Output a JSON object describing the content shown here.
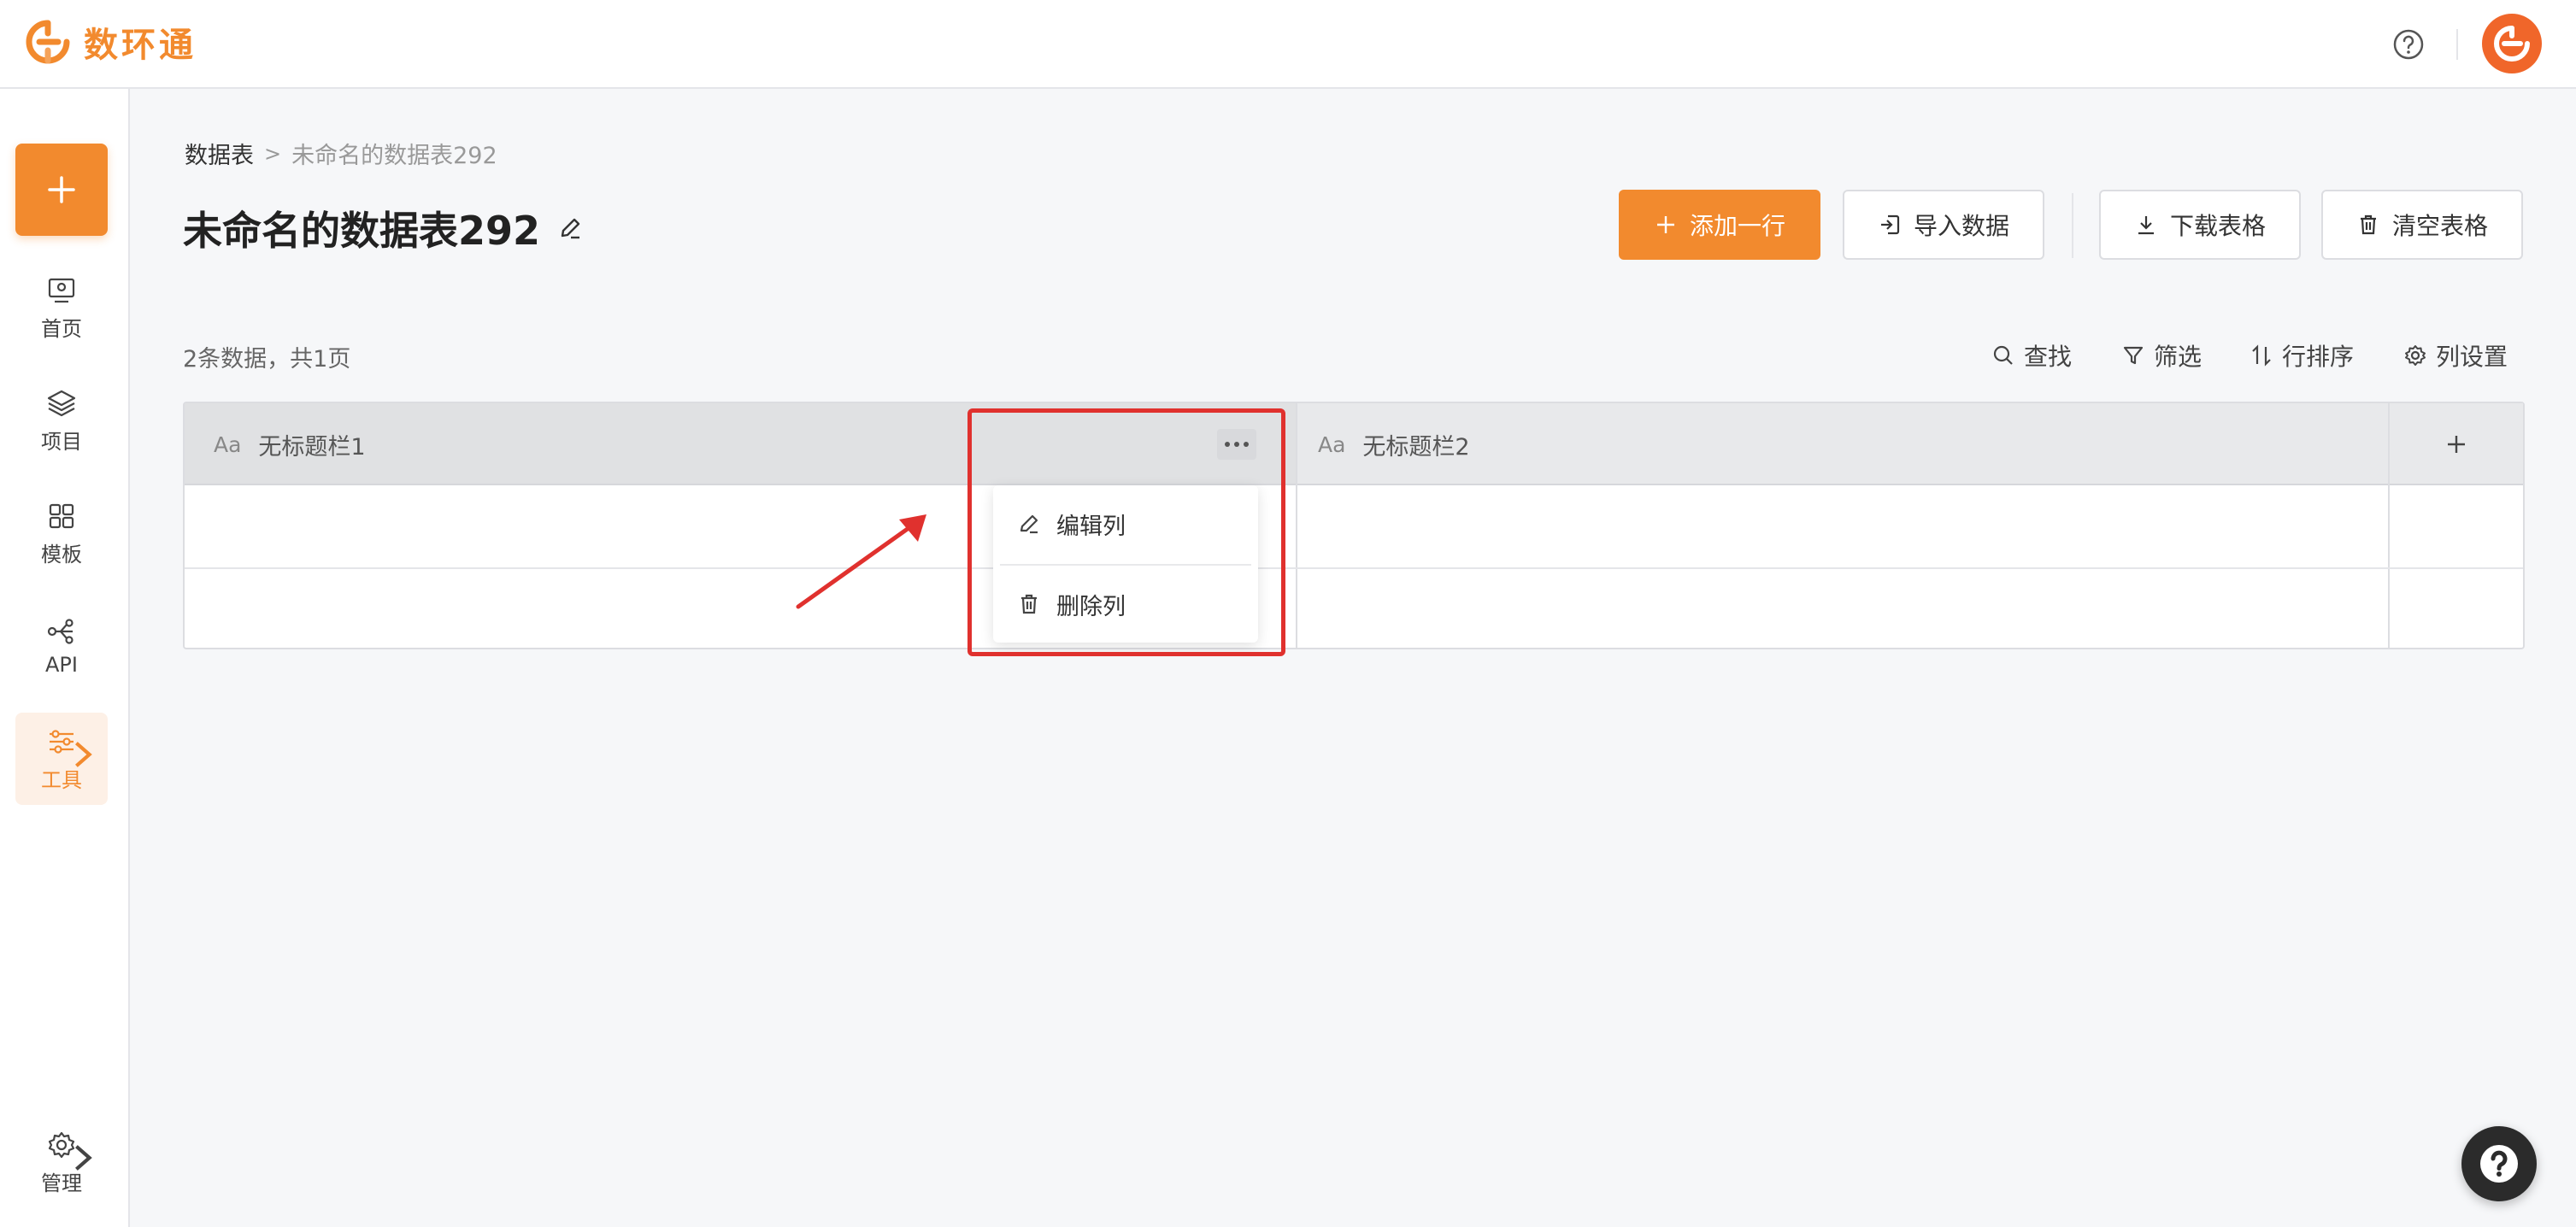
{
  "app": {
    "brand": "数环通"
  },
  "colors": {
    "accent": "#f28a2e",
    "annotation": "#e0312e"
  },
  "sidenav": {
    "items": [
      {
        "label": "首页",
        "icon": "monitor-icon"
      },
      {
        "label": "项目",
        "icon": "layers-icon"
      },
      {
        "label": "模板",
        "icon": "grid-icon"
      },
      {
        "label": "API",
        "icon": "api-icon"
      },
      {
        "label": "工具",
        "icon": "sliders-icon",
        "active": true
      },
      {
        "label": "管理",
        "icon": "gear-icon"
      }
    ]
  },
  "breadcrumb": {
    "root": "数据表",
    "separator": ">",
    "current": "未命名的数据表292"
  },
  "page": {
    "title": "未命名的数据表292"
  },
  "actions": {
    "add_row": "添加一行",
    "import": "导入数据",
    "download": "下载表格",
    "clear": "清空表格"
  },
  "summary": "2条数据，共1页",
  "toolbar": {
    "search": "查找",
    "filter": "筛选",
    "sort": "行排序",
    "columns": "列设置"
  },
  "table": {
    "columns": [
      {
        "type_icon": "Aa",
        "name": "无标题栏1"
      },
      {
        "type_icon": "Aa",
        "name": "无标题栏2"
      }
    ],
    "row_count": 2
  },
  "column_menu": {
    "edit": "编辑列",
    "delete": "删除列"
  }
}
